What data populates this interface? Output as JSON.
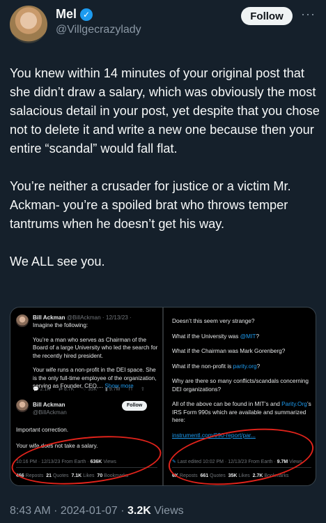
{
  "author": {
    "name": "Mel",
    "handle": "@Villgecrazylady",
    "follow_label": "Follow",
    "more_label": "···"
  },
  "tweet": {
    "paragraphs": [
      "You knew within 14 minutes of your original post that she didn’t draw a salary, which was obviously the most salacious detail in your post, yet despite that you chose not to delete it and write a new one because then your entire “scandal” would fall flat.",
      "You’re neither a crusader for justice or a victim Mr. Ackman- you’re a spoiled brat who throws temper tantrums when he doesn’t get his way.",
      "We ALL see you."
    ]
  },
  "embedded_left": {
    "quoted": {
      "name": "Bill Ackman",
      "meta": "@BillAckman · 12/13/23 ·",
      "intro": "Imagine the following:",
      "para1": "You’re a man who serves as Chairman of the Board of a large University who led the search for the recently hired president.",
      "para2": "Your wife runs a non-profit in the DEI space.  She is the only full-time employee of the organization, serving as Founder, CEO,...",
      "show_more": "Show more",
      "actions": [
        "2.1K",
        "8.7K",
        "35K",
        "9.7M"
      ]
    },
    "reply": {
      "name": "Bill Ackman",
      "handle": "@BillAckman",
      "follow_label": "Follow",
      "line1": "Important correction.",
      "line2": "Your wife does not take a salary.",
      "meta_time": "10:16 PM · 12/13/23 From Earth ·",
      "views": "636K",
      "views_label": "Views",
      "stats": [
        {
          "value": "466",
          "label": "Reposts"
        },
        {
          "value": "21",
          "label": "Quotes"
        },
        {
          "value": "7.1K",
          "label": "Likes"
        },
        {
          "value": "70",
          "label": "Bookmarks"
        }
      ]
    }
  },
  "embedded_right": {
    "q1": "Doesn’t this seem very strange?",
    "q2_pre": "What if the University was ",
    "q2_link": "@MIT",
    "q2_post": "?",
    "q3": "What if the Chairman was Mark Gorenberg?",
    "q4_pre": "What if the non-profit is ",
    "q4_link": "parity.org",
    "q4_post": "?",
    "q5": "Why are there so many conflicts/scandals concerning DEI organizations?",
    "q6_pre": "All of the above can be found in MIT’s and ",
    "q6_link": "Parity.Org",
    "q6_post": "’s IRS Form 990s which are available and summarized here:",
    "url": "instrumentl.com/990-report/par...",
    "meta_time": "Last edited 10:02 PM · 12/13/23 From Earth ·",
    "views": "9.7M",
    "views_label": "Views",
    "stats": [
      {
        "value": "6K",
        "label": "Reposts"
      },
      {
        "value": "661",
        "label": "Quotes"
      },
      {
        "value": "35K",
        "label": "Likes"
      },
      {
        "value": "2.7K",
        "label": "Bookmarks"
      }
    ]
  },
  "footer": {
    "time": "8:43 AM",
    "date": "2024-01-07",
    "views": "3.2K",
    "views_label": "Views"
  },
  "colors": {
    "background": "#15202b",
    "accent": "#1d9bf0",
    "annotation": "#e0231b"
  }
}
